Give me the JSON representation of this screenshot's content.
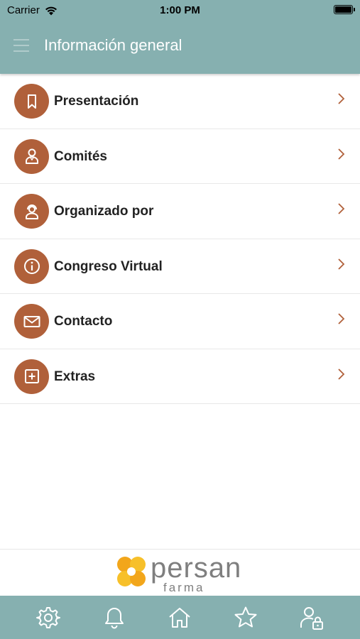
{
  "status": {
    "carrier": "Carrier",
    "time": "1:00 PM"
  },
  "header": {
    "title": "Información general"
  },
  "menu": [
    {
      "label": "Presentación",
      "icon": "bookmark-icon"
    },
    {
      "label": "Comités",
      "icon": "person-icon"
    },
    {
      "label": "Organizado por",
      "icon": "headset-person-icon"
    },
    {
      "label": "Congreso Virtual",
      "icon": "info-icon"
    },
    {
      "label": "Contacto",
      "icon": "mail-icon"
    },
    {
      "label": "Extras",
      "icon": "plus-square-icon"
    }
  ],
  "sponsor": {
    "brand_main": "persan",
    "brand_sub": "farma"
  },
  "tabs": [
    {
      "icon": "settings-gear-icon"
    },
    {
      "icon": "bell-icon"
    },
    {
      "icon": "home-icon"
    },
    {
      "icon": "star-icon"
    },
    {
      "icon": "user-lock-icon"
    }
  ],
  "colors": {
    "header": "#86b0b0",
    "accent": "#b0603a",
    "tabbar": "#86b0b0",
    "chevron": "#b0603a"
  }
}
